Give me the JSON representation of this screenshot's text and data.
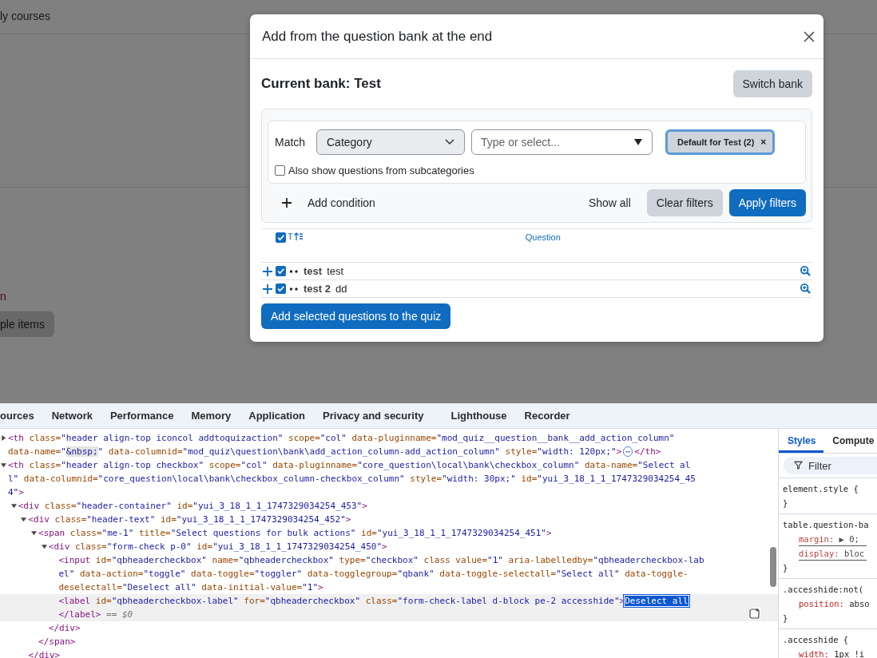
{
  "background_page": {
    "nav_link": "ly courses",
    "text_fragment": "n",
    "button": "ple items"
  },
  "dialog": {
    "title": "Add from the question bank at the end",
    "current_bank": "Current bank: Test",
    "switch_button": "Switch bank",
    "filter": {
      "match_label": "Match",
      "condition_type": "Category",
      "value_placeholder": "Type or select...",
      "chip": "Default for Test (2)",
      "chip_remove": "×",
      "subcategories": {
        "label": "Also show questions from subcategories",
        "checked": false
      },
      "add_condition": "Add condition",
      "show_all": "Show all",
      "clear_button": "Clear filters",
      "apply_button": "Apply filters"
    },
    "table": {
      "header": {
        "checked": true,
        "type_column": "T",
        "question_column": "Question"
      },
      "rows": [
        {
          "checked": true,
          "name": "test",
          "text": "test"
        },
        {
          "checked": true,
          "name": "test 2",
          "text": "dd"
        }
      ]
    },
    "add_button": "Add selected questions to the quiz"
  },
  "devtools": {
    "tabs": [
      {
        "label": "ources",
        "selected": false
      },
      {
        "label": "Network",
        "selected": false
      },
      {
        "label": "Performance",
        "selected": false
      },
      {
        "label": "Memory",
        "selected": false
      },
      {
        "label": "Application",
        "selected": false
      },
      {
        "label": "Privacy and security",
        "selected": false
      },
      {
        "label": "Lighthouse",
        "selected": false
      },
      {
        "label": "Recorder",
        "selected": false
      }
    ],
    "dom": [
      {
        "expanded": false,
        "lines": [
          [
            {
              "kind": "tag",
              "text": "<th"
            },
            {
              "kind": "attr",
              "text": " class="
            },
            {
              "kind": "val",
              "text": "\"header align-top iconcol addtoquizaction\""
            },
            {
              "kind": "attr",
              "text": " scope="
            },
            {
              "kind": "val",
              "text": "\"col\""
            },
            {
              "kind": "attr",
              "text": " data-pluginname="
            },
            {
              "kind": "val",
              "text": "\"mod_quiz__question__bank__add_action_column\""
            }
          ],
          [
            {
              "kind": "attr",
              "text": "data-name="
            },
            {
              "kind": "val",
              "text": "\""
            },
            {
              "kind": "entity",
              "text": "&nbsp;"
            },
            {
              "kind": "val",
              "text": "\""
            },
            {
              "kind": "attr",
              "text": " data-columnid="
            },
            {
              "kind": "val",
              "text": "\"mod_quiz\\question\\bank\\add_action_column-add_action_column\""
            },
            {
              "kind": "attr",
              "text": " style="
            },
            {
              "kind": "val",
              "text": "\"width: 120px;\""
            },
            {
              "kind": "tag",
              "text": ">"
            },
            {
              "kind": "more",
              "text": "⋯"
            },
            {
              "kind": "tag",
              "text": "</th>"
            }
          ]
        ]
      },
      {
        "expanded": true,
        "lines": [
          [
            {
              "kind": "tag",
              "text": "<th"
            },
            {
              "kind": "attr",
              "text": " class="
            },
            {
              "kind": "val",
              "text": "\"header align-top checkbox\""
            },
            {
              "kind": "attr",
              "text": " scope="
            },
            {
              "kind": "val",
              "text": "\"col\""
            },
            {
              "kind": "attr",
              "text": " data-pluginname="
            },
            {
              "kind": "val",
              "text": "\"core_question\\local\\bank\\checkbox_column\""
            },
            {
              "kind": "attr",
              "text": " data-name="
            },
            {
              "kind": "val",
              "text": "\"Select al"
            }
          ],
          [
            {
              "kind": "val",
              "text": "l\""
            },
            {
              "kind": "attr",
              "text": " data-columnid="
            },
            {
              "kind": "val",
              "text": "\"core_question\\local\\bank\\checkbox_column-checkbox_column\""
            },
            {
              "kind": "attr",
              "text": " style="
            },
            {
              "kind": "val",
              "text": "\"width: 30px;\""
            },
            {
              "kind": "attr",
              "text": " id="
            },
            {
              "kind": "val",
              "text": "\"yui_3_18_1_1_1747329034254_45"
            }
          ],
          [
            {
              "kind": "val",
              "text": "4\""
            },
            {
              "kind": "tag",
              "text": ">"
            }
          ]
        ],
        "children": [
          {
            "expanded": true,
            "lines": [
              [
                {
                  "kind": "tag",
                  "text": "<div"
                },
                {
                  "kind": "attr",
                  "text": " class="
                },
                {
                  "kind": "val",
                  "text": "\"header-container\""
                },
                {
                  "kind": "attr",
                  "text": " id="
                },
                {
                  "kind": "val",
                  "text": "\"yui_3_18_1_1_1747329034254_453\""
                },
                {
                  "kind": "tag",
                  "text": ">"
                }
              ]
            ],
            "children": [
              {
                "expanded": true,
                "lines": [
                  [
                    {
                      "kind": "tag",
                      "text": "<div"
                    },
                    {
                      "kind": "attr",
                      "text": " class="
                    },
                    {
                      "kind": "val",
                      "text": "\"header-text\""
                    },
                    {
                      "kind": "attr",
                      "text": " id="
                    },
                    {
                      "kind": "val",
                      "text": "\"yui_3_18_1_1_1747329034254_452\""
                    },
                    {
                      "kind": "tag",
                      "text": ">"
                    }
                  ]
                ],
                "closing": [
                  {
                    "kind": "tag",
                    "text": "</div>"
                  }
                ],
                "children": [
                  {
                    "expanded": true,
                    "lines": [
                      [
                        {
                          "kind": "tag",
                          "text": "<span"
                        },
                        {
                          "kind": "attr",
                          "text": " class="
                        },
                        {
                          "kind": "val",
                          "text": "\"me-1\""
                        },
                        {
                          "kind": "attr",
                          "text": " title="
                        },
                        {
                          "kind": "val",
                          "text": "\"Select questions for bulk actions\""
                        },
                        {
                          "kind": "attr",
                          "text": " id="
                        },
                        {
                          "kind": "val",
                          "text": "\"yui_3_18_1_1_1747329034254_451\""
                        },
                        {
                          "kind": "tag",
                          "text": ">"
                        }
                      ]
                    ],
                    "closing": [
                      {
                        "kind": "tag",
                        "text": "</span>"
                      }
                    ],
                    "children": [
                      {
                        "expanded": true,
                        "lines": [
                          [
                            {
                              "kind": "tag",
                              "text": "<div"
                            },
                            {
                              "kind": "attr",
                              "text": " class="
                            },
                            {
                              "kind": "val",
                              "text": "\"form-check p-0\""
                            },
                            {
                              "kind": "attr",
                              "text": " id="
                            },
                            {
                              "kind": "val",
                              "text": "\"yui_3_18_1_1_1747329034254_450\""
                            },
                            {
                              "kind": "tag",
                              "text": ">"
                            }
                          ]
                        ],
                        "closing": [
                          {
                            "kind": "tag",
                            "text": "</div>"
                          }
                        ],
                        "children": [
                          {
                            "lines": [
                              [
                                {
                                  "kind": "tag",
                                  "text": "<input"
                                },
                                {
                                  "kind": "attr",
                                  "text": " id="
                                },
                                {
                                  "kind": "val",
                                  "text": "\"qbheadercheckbox\""
                                },
                                {
                                  "kind": "attr",
                                  "text": " name="
                                },
                                {
                                  "kind": "val",
                                  "text": "\"qbheadercheckbox\""
                                },
                                {
                                  "kind": "attr",
                                  "text": " type="
                                },
                                {
                                  "kind": "val",
                                  "text": "\"checkbox\""
                                },
                                {
                                  "kind": "attr",
                                  "text": " class value="
                                },
                                {
                                  "kind": "val",
                                  "text": "\"1\""
                                },
                                {
                                  "kind": "attr",
                                  "text": " aria-labelledby="
                                },
                                {
                                  "kind": "val",
                                  "text": "\"qbheadercheckbox-lab"
                                }
                              ],
                              [
                                {
                                  "kind": "val",
                                  "text": "el\""
                                },
                                {
                                  "kind": "attr",
                                  "text": " data-action="
                                },
                                {
                                  "kind": "val",
                                  "text": "\"toggle\""
                                },
                                {
                                  "kind": "attr",
                                  "text": " data-toggle="
                                },
                                {
                                  "kind": "val",
                                  "text": "\"toggler\""
                                },
                                {
                                  "kind": "attr",
                                  "text": " data-togglegroup="
                                },
                                {
                                  "kind": "val",
                                  "text": "\"qbank\""
                                },
                                {
                                  "kind": "attr",
                                  "text": " data-toggle-selectall="
                                },
                                {
                                  "kind": "val",
                                  "text": "\"Select all\""
                                },
                                {
                                  "kind": "attr",
                                  "text": " data-toggle-"
                                }
                              ],
                              [
                                {
                                  "kind": "attr",
                                  "text": "deselectall="
                                },
                                {
                                  "kind": "val",
                                  "text": "\"Deselect all\""
                                },
                                {
                                  "kind": "attr",
                                  "text": " data-initial-value="
                                },
                                {
                                  "kind": "val",
                                  "text": "\"1\""
                                },
                                {
                                  "kind": "tag",
                                  "text": ">"
                                }
                              ]
                            ]
                          },
                          {
                            "selected": true,
                            "lines": [
                              [
                                {
                                  "kind": "tag",
                                  "text": "<label"
                                },
                                {
                                  "kind": "attr",
                                  "text": " id="
                                },
                                {
                                  "kind": "val",
                                  "text": "\"qbheadercheckbox-label\""
                                },
                                {
                                  "kind": "attr",
                                  "text": " for="
                                },
                                {
                                  "kind": "val",
                                  "text": "\"qbheadercheckbox\""
                                },
                                {
                                  "kind": "attr",
                                  "text": " class="
                                },
                                {
                                  "kind": "val",
                                  "text": "\"form-check-label d-block pe-2 accesshide\""
                                },
                                {
                                  "kind": "tag",
                                  "text": ">"
                                },
                                {
                                  "kind": "sel",
                                  "text": "Deselect all"
                                }
                              ],
                              [
                                {
                                  "kind": "tag",
                                  "text": "</label>"
                                },
                                {
                                  "kind": "dim",
                                  "text": " == $0"
                                }
                              ]
                            ]
                          }
                        ]
                      }
                    ]
                  }
                ]
              }
            ]
          }
        ]
      }
    ],
    "styles": {
      "tabs": [
        {
          "label": "Styles",
          "selected": true
        },
        {
          "label": "Compute",
          "selected": false
        }
      ],
      "filter_placeholder": "Filter",
      "rules": [
        {
          "selector": "element.style {",
          "close": "}"
        },
        {
          "selector": "table.question-ba",
          "declarations": [
            {
              "property": "margin:",
              "value": "▶ 0;",
              "struck": true
            },
            {
              "property": "display:",
              "value": "bloc",
              "struck": true
            }
          ],
          "close": "}"
        },
        {
          "selector": ".accesshide:not(",
          "declarations": [
            {
              "property": "position:",
              "value": "abso",
              "struck": false
            }
          ],
          "close": "}"
        },
        {
          "selector": ".accesshide {",
          "declarations": [
            {
              "property": "width:",
              "value": "1px !i",
              "struck": false
            }
          ]
        }
      ]
    }
  }
}
